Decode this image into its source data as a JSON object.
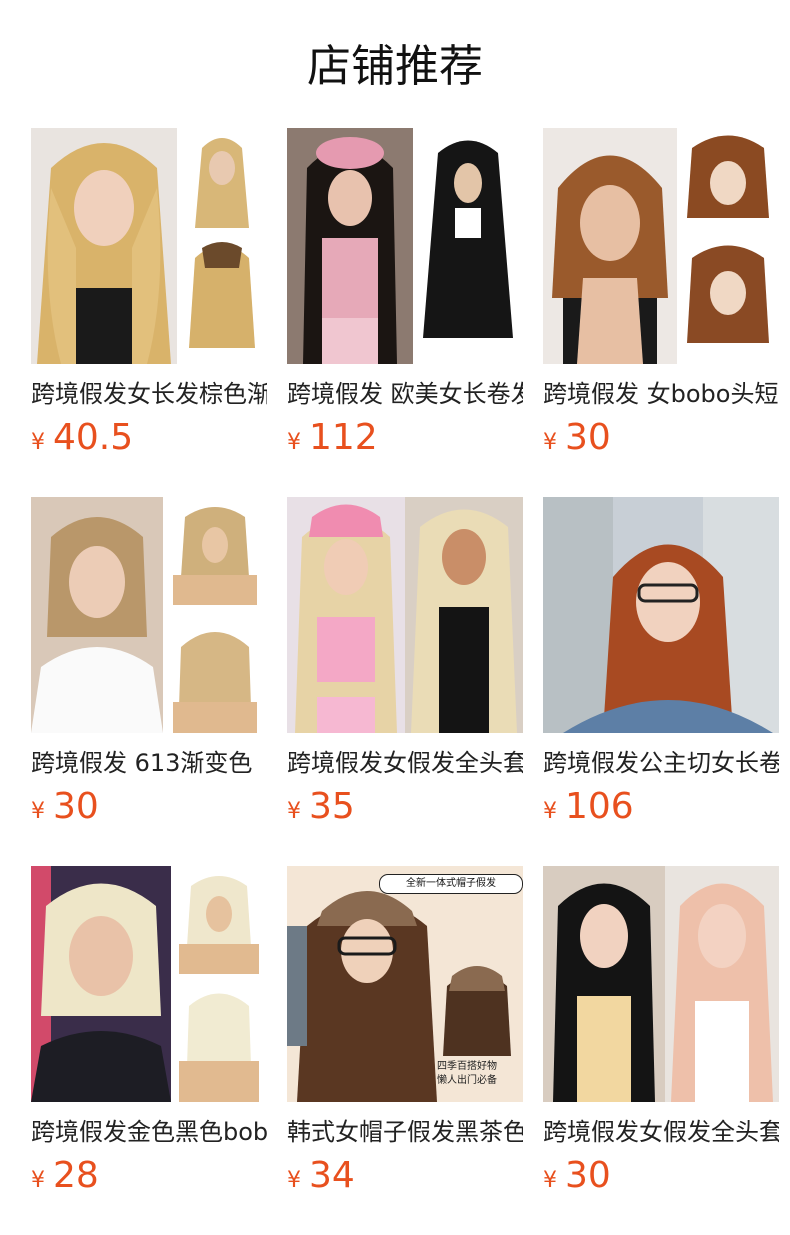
{
  "section_title": "店铺推荐",
  "currency_symbol": "¥",
  "accent_color": "#e8501e",
  "products": [
    {
      "name": "跨境假发女长发棕色渐变",
      "price": "40.5"
    },
    {
      "name": "跨境假发 欧美女长卷发",
      "price": "112"
    },
    {
      "name": "跨境假发 女bobo头短发",
      "price": "30"
    },
    {
      "name": "跨境假发 613渐变色",
      "price": "30"
    },
    {
      "name": "跨境假发女假发全头套",
      "price": "35"
    },
    {
      "name": "跨境假发公主切女长卷发",
      "price": "106"
    },
    {
      "name": "跨境假发金色黑色bobo",
      "price": "28"
    },
    {
      "name": "韩式女帽子假发黑茶色",
      "price": "34"
    },
    {
      "name": "跨境假发女假发全头套",
      "price": "30"
    }
  ],
  "hat_card": {
    "banner": "全新一体式帽子假发",
    "tagline_1": "四季百搭好物",
    "tagline_2": "懒人出门必备"
  }
}
